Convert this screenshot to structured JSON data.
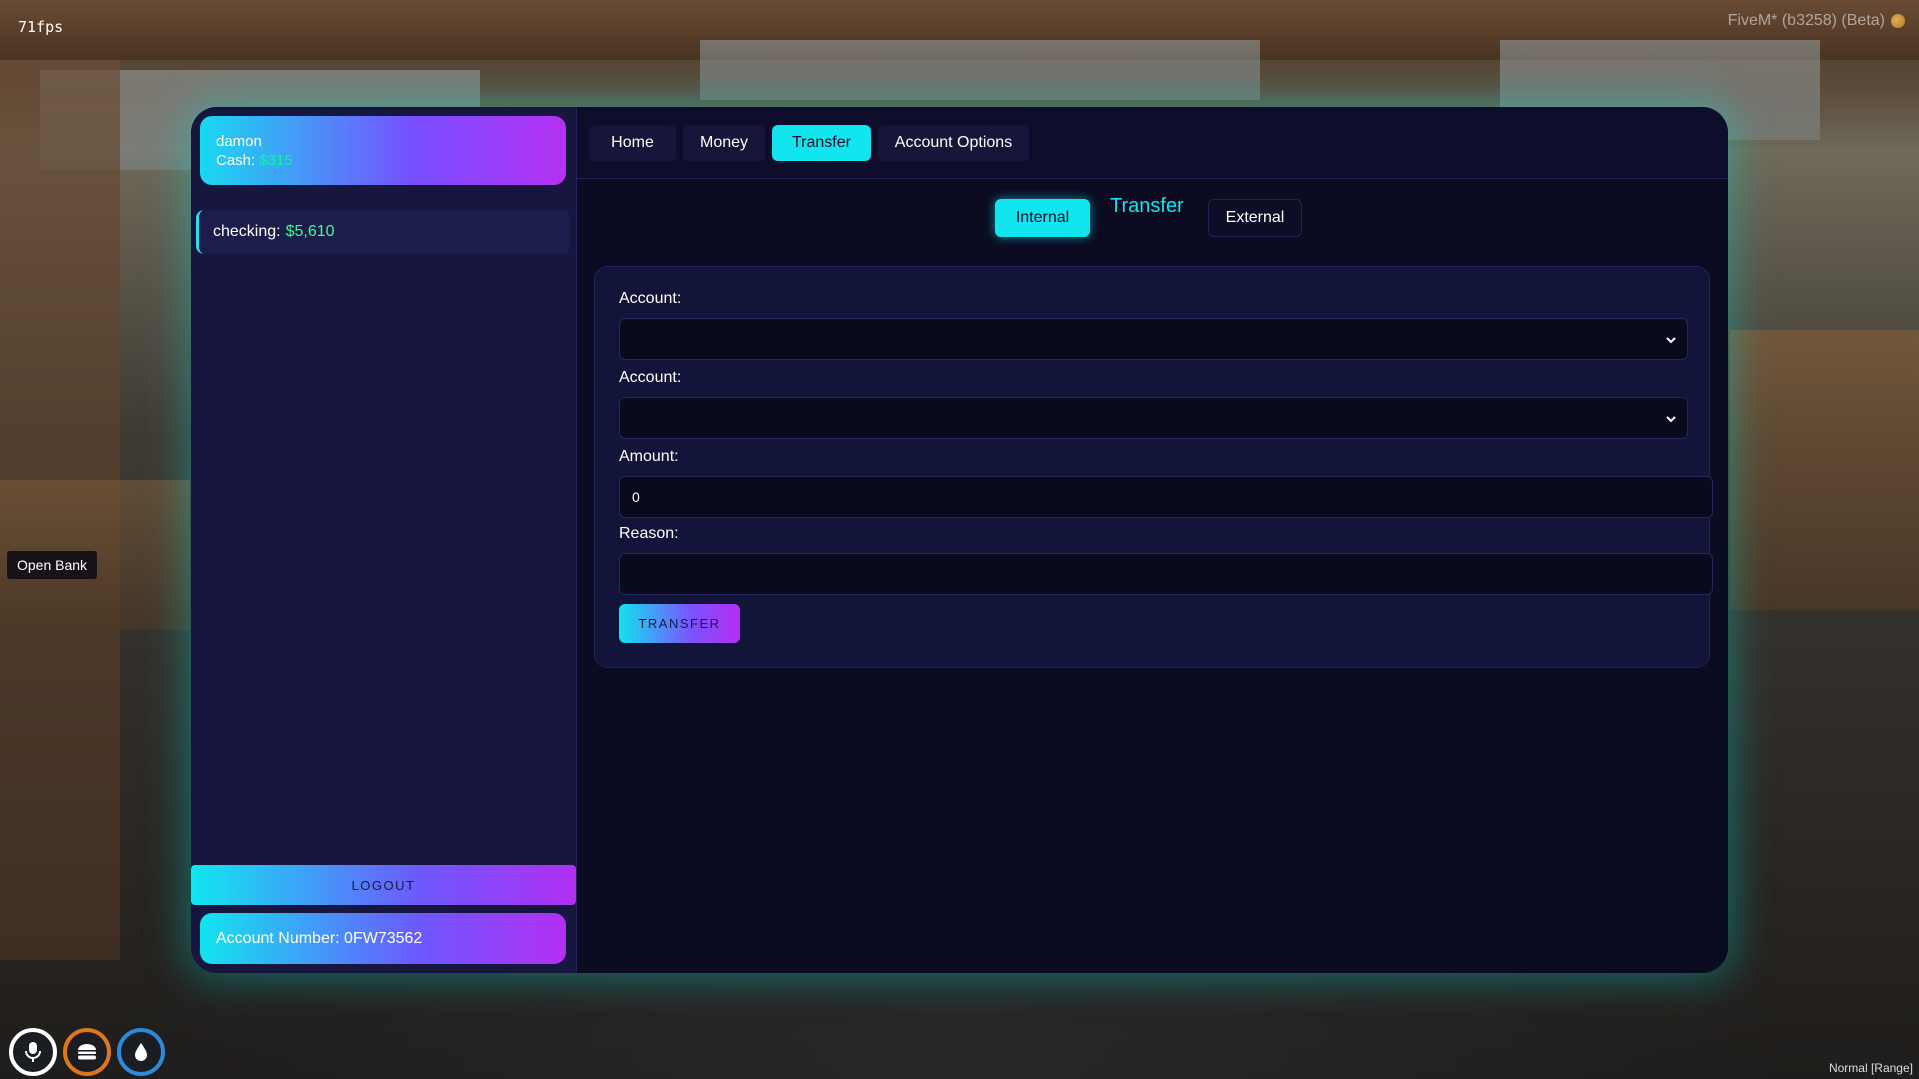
{
  "overlay": {
    "fps": "71fps",
    "client_version": "FiveM* (b3258) (Beta)",
    "voice_mode": "Normal [Range]",
    "prompt": "Open Bank"
  },
  "hud": [
    {
      "icon": "microphone-icon",
      "ring_color": "#ffffff"
    },
    {
      "icon": "burger-icon",
      "ring_color": "#e0761c"
    },
    {
      "icon": "water-drop-icon",
      "ring_color": "#2d8ad8"
    }
  ],
  "profile": {
    "name": "damon",
    "cash_label": "Cash:",
    "cash_value": "$315"
  },
  "accounts": [
    {
      "name": "checking:",
      "balance": "$5,610"
    }
  ],
  "sidebar": {
    "logout_label": "LOGOUT",
    "account_number": "Account Number: 0FW73562"
  },
  "tabs": [
    {
      "label": "Home",
      "active": false
    },
    {
      "label": "Money",
      "active": false
    },
    {
      "label": "Transfer",
      "active": true
    },
    {
      "label": "Account Options",
      "active": false
    }
  ],
  "transfer": {
    "internal_label": "Internal",
    "title": "Transfer",
    "external_label": "External",
    "from_label": "Account:",
    "to_label": "Account:",
    "amount_label": "Amount:",
    "amount_value": "0",
    "reason_label": "Reason:",
    "reason_value": "",
    "submit_label": "TRANSFER"
  },
  "colors": {
    "accent": "#11e6ee",
    "gradient_end": "#b42ff2",
    "money_green": "#3dff8a"
  }
}
